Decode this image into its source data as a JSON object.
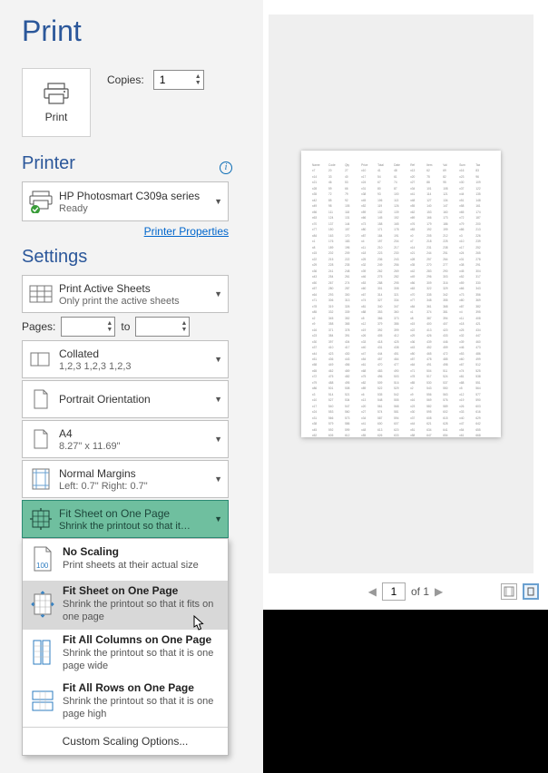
{
  "title": "Print",
  "print_button": {
    "label": "Print"
  },
  "copies": {
    "label": "Copies:",
    "value": "1"
  },
  "printer_section": {
    "heading": "Printer",
    "name": "HP Photosmart C309a series",
    "status": "Ready",
    "properties_link": "Printer Properties"
  },
  "settings_section": {
    "heading": "Settings",
    "active_sheets": {
      "title": "Print Active Sheets",
      "sub": "Only print the active sheets"
    },
    "pages_label": "Pages:",
    "pages_to": "to",
    "collated": {
      "title": "Collated",
      "sub": "1,2,3    1,2,3    1,2,3"
    },
    "orientation": {
      "title": "Portrait Orientation"
    },
    "paper": {
      "title": "A4",
      "sub": "8.27\" x 11.69\""
    },
    "margins": {
      "title": "Normal Margins",
      "sub": "Left:  0.7\"    Right:  0.7\""
    },
    "scaling_selected": {
      "title": "Fit Sheet on One Page",
      "sub": "Shrink the printout so that it…"
    },
    "scaling_menu": {
      "no_scaling": {
        "title": "No Scaling",
        "sub": "Print sheets at their actual size"
      },
      "fit_sheet": {
        "title": "Fit Sheet on One Page",
        "sub": "Shrink the printout so that it fits on one page"
      },
      "fit_cols": {
        "title": "Fit All Columns on One Page",
        "sub": "Shrink the printout so that it is one page wide"
      },
      "fit_rows": {
        "title": "Fit All Rows on One Page",
        "sub": "Shrink the printout so that it is one page high"
      },
      "footer": "Custom Scaling Options..."
    }
  },
  "pager": {
    "page": "1",
    "of_label": "of 1"
  }
}
